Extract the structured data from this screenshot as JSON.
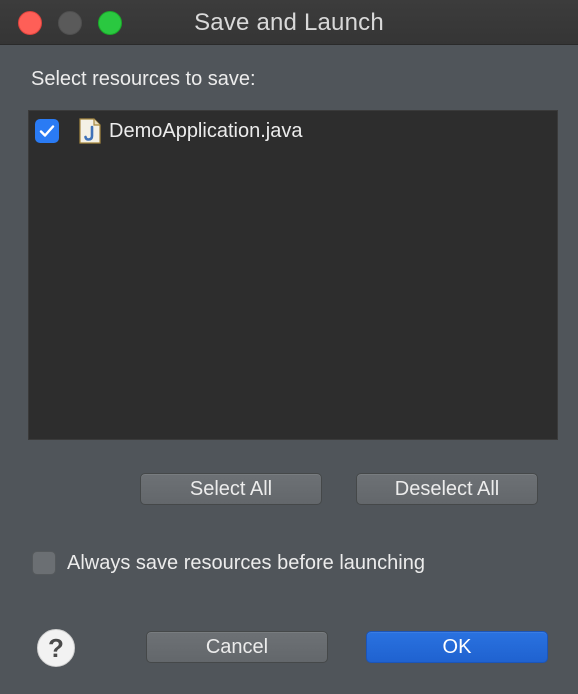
{
  "window": {
    "title": "Save and Launch"
  },
  "content": {
    "prompt": "Select resources to save:",
    "resources": [
      {
        "name": "DemoApplication.java",
        "checked": true,
        "icon": "java-file-icon"
      }
    ],
    "select_all_label": "Select All",
    "deselect_all_label": "Deselect All",
    "always_save_label": "Always save resources before launching",
    "always_save_checked": false
  },
  "footer": {
    "help_glyph": "?",
    "cancel_label": "Cancel",
    "ok_label": "OK"
  },
  "colors": {
    "accent": "#2a7bf4",
    "close": "#fe5f57",
    "maximize": "#2ac840"
  }
}
